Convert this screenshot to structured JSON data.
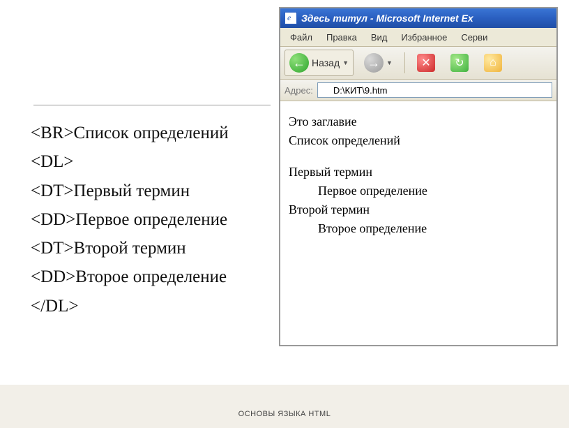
{
  "code": {
    "l1": "<BR>Список определений",
    "l2": "<DL>",
    "l3": "<DT>Первый термин",
    "l4": "<DD>Первое определение",
    "l5": "<DT>Второй термин",
    "l6": "<DD>Второе определение",
    "l7": "</DL>"
  },
  "browser": {
    "title": "Здесь титул - Microsoft Internet Ex",
    "menu": {
      "file": "Файл",
      "edit": "Правка",
      "view": "Вид",
      "favorites": "Избранное",
      "services": "Серви"
    },
    "toolbar": {
      "back_label": "Назад"
    },
    "address_bar": {
      "label": "Адрес:",
      "value": "D:\\КИТ\\9.htm"
    },
    "page": {
      "heading": "Это заглавие",
      "subtitle": "Список определений",
      "dt1": "Первый термин",
      "dd1": "Первое определение",
      "dt2": "Второй термин",
      "dd2": "Второе определение"
    }
  },
  "footer": "ОСНОВЫ ЯЗЫКА HTML"
}
